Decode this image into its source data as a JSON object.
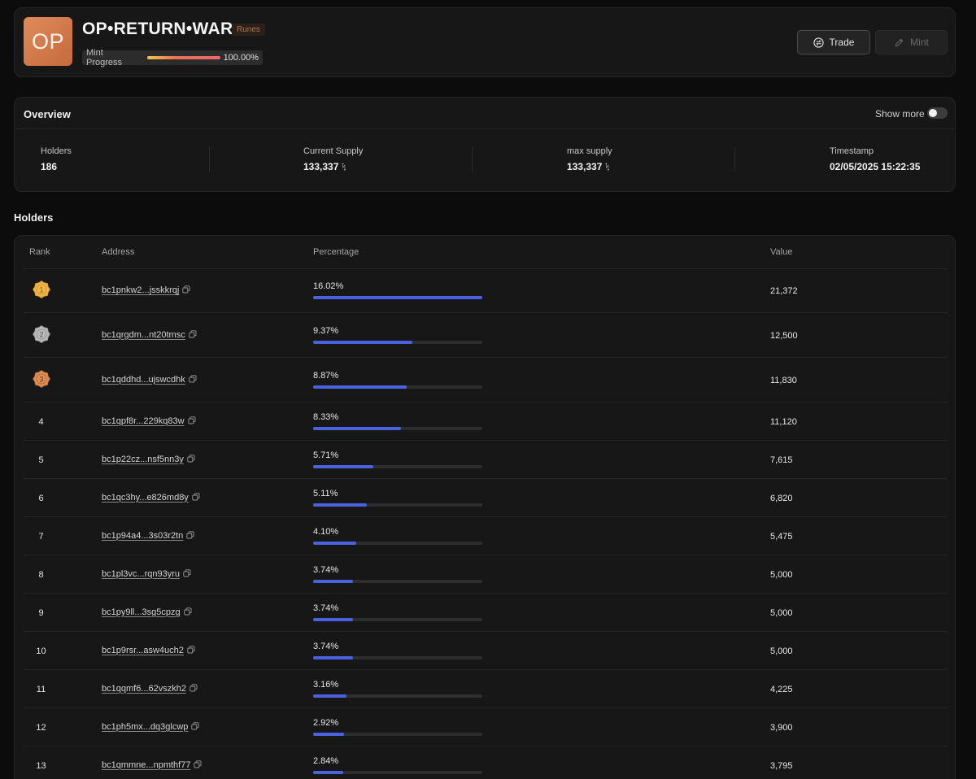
{
  "header": {
    "logo_text": "OP",
    "title": "OP•RETURN•WAR",
    "badge": "Runes",
    "mint_progress_label": "Mint Progress",
    "mint_progress_value": "100.00%",
    "mint_progress_fraction": 1.0,
    "trade_label": "Trade",
    "mint_label": "Mint"
  },
  "overview": {
    "title": "Overview",
    "show_more_label": "Show more",
    "show_more_on": false,
    "stats": [
      {
        "label": "Holders",
        "value": "186",
        "unit": ""
      },
      {
        "label": "Current Supply",
        "value": "133,337",
        "unit": "ᛪ"
      },
      {
        "label": "max supply",
        "value": "133,337",
        "unit": "ᛪ"
      },
      {
        "label": "Timestamp",
        "value": "02/05/2025 15:22:35",
        "unit": ""
      }
    ]
  },
  "holders": {
    "title": "Holders",
    "columns": {
      "rank": "Rank",
      "address": "Address",
      "percentage": "Percentage",
      "value": "Value"
    },
    "rows": [
      {
        "rank": "1",
        "medal": "gold",
        "address": "bc1pnkw2...jsskkrqj",
        "percentage": "16.02%",
        "pct": 16.02,
        "value": "21,372"
      },
      {
        "rank": "2",
        "medal": "silver",
        "address": "bc1qrgdm...nt20tmsc",
        "percentage": "9.37%",
        "pct": 9.37,
        "value": "12,500"
      },
      {
        "rank": "3",
        "medal": "bronze",
        "address": "bc1qddhd...ujswcdhk",
        "percentage": "8.87%",
        "pct": 8.87,
        "value": "11,830"
      },
      {
        "rank": "4",
        "medal": "",
        "address": "bc1qpf8r...229kq83w",
        "percentage": "8.33%",
        "pct": 8.33,
        "value": "11,120"
      },
      {
        "rank": "5",
        "medal": "",
        "address": "bc1p22cz...nsf5nn3y",
        "percentage": "5.71%",
        "pct": 5.71,
        "value": "7,615"
      },
      {
        "rank": "6",
        "medal": "",
        "address": "bc1qc3hy...e826md8y",
        "percentage": "5.11%",
        "pct": 5.11,
        "value": "6,820"
      },
      {
        "rank": "7",
        "medal": "",
        "address": "bc1p94a4...3s03r2tn",
        "percentage": "4.10%",
        "pct": 4.1,
        "value": "5,475"
      },
      {
        "rank": "8",
        "medal": "",
        "address": "bc1pl3vc...rqn93yru",
        "percentage": "3.74%",
        "pct": 3.74,
        "value": "5,000"
      },
      {
        "rank": "9",
        "medal": "",
        "address": "bc1py9ll...3sg5cpzg",
        "percentage": "3.74%",
        "pct": 3.74,
        "value": "5,000"
      },
      {
        "rank": "10",
        "medal": "",
        "address": "bc1p9rsr...asw4uch2",
        "percentage": "3.74%",
        "pct": 3.74,
        "value": "5,000"
      },
      {
        "rank": "11",
        "medal": "",
        "address": "bc1qqmf6...62vszkh2",
        "percentage": "3.16%",
        "pct": 3.16,
        "value": "4,225"
      },
      {
        "rank": "12",
        "medal": "",
        "address": "bc1ph5mx...dq3glcwp",
        "percentage": "2.92%",
        "pct": 2.92,
        "value": "3,900"
      },
      {
        "rank": "13",
        "medal": "",
        "address": "bc1qmmne...npmthf77",
        "percentage": "2.84%",
        "pct": 2.84,
        "value": "3,795"
      }
    ]
  },
  "colors": {
    "accent": "#4a62e0",
    "gold": "#e7a93a",
    "silver": "#a9a9a9",
    "bronze": "#d4874c"
  }
}
